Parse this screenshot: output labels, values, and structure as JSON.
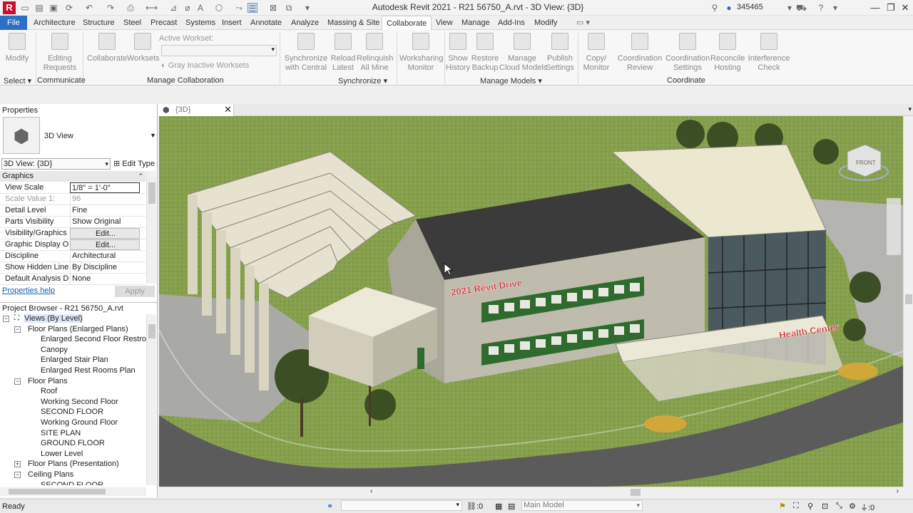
{
  "app": {
    "title": "Autodesk Revit 2021 - R21 56750_A.rvt - 3D View: {3D}",
    "user": "345465",
    "logo_letter": "R"
  },
  "tabs": [
    "File",
    "Architecture",
    "Structure",
    "Steel",
    "Precast",
    "Systems",
    "Insert",
    "Annotate",
    "Analyze",
    "Massing & Site",
    "Collaborate",
    "View",
    "Manage",
    "Add-Ins",
    "Modify"
  ],
  "active_tab": "Collaborate",
  "ribbon": {
    "modify": "Modify",
    "editing_requests": "Editing\nRequests",
    "collaborate": "Collaborate",
    "worksets": "Worksets",
    "active_workset_label": "Active Workset:",
    "gray_inactive": "Gray Inactive Worksets",
    "sync_central": "Synchronize\nwith Central",
    "reload_latest": "Reload\nLatest",
    "relinquish": "Relinquish\nAll Mine",
    "ws_monitor": "Worksharing\nMonitor",
    "show_history": "Show\nHistory",
    "restore_backup": "Restore\nBackup",
    "manage_cloud": "Manage\nCloud Models",
    "publish_settings": "Publish\nSettings",
    "copy_monitor": "Copy/\nMonitor",
    "coord_review": "Coordination\nReview",
    "coord_settings": "Coordination\nSettings",
    "reconcile": "Reconcile\nHosting",
    "interference": "Interference\nCheck",
    "panels": {
      "select": "Select",
      "communicate": "Communicate",
      "manage_collab": "Manage Collaboration",
      "synchronize": "Synchronize",
      "manage_models": "Manage Models",
      "coordinate": "Coordinate"
    }
  },
  "properties": {
    "title": "Properties",
    "type_name": "3D View",
    "instance": "3D View: {3D}",
    "edit_type": "Edit Type",
    "section": "Graphics",
    "rows": [
      {
        "k": "View Scale",
        "v": "1/8\" = 1'-0\""
      },
      {
        "k": "Scale Value    1:",
        "v": "96"
      },
      {
        "k": "Detail Level",
        "v": "Fine"
      },
      {
        "k": "Parts Visibility",
        "v": "Show Original"
      },
      {
        "k": "Visibility/Graphics ...",
        "v": "Edit..."
      },
      {
        "k": "Graphic Display O...",
        "v": "Edit..."
      },
      {
        "k": "Discipline",
        "v": "Architectural"
      },
      {
        "k": "Show Hidden Lines",
        "v": "By Discipline"
      },
      {
        "k": "Default Analysis Di...",
        "v": "None"
      }
    ],
    "help": "Properties help",
    "apply": "Apply"
  },
  "browser": {
    "title": "Project Browser - R21 56750_A.rvt",
    "items": [
      {
        "label": "Views (By Level)",
        "level": 0,
        "toggle": "−"
      },
      {
        "label": "Floor Plans (Enlarged Plans)",
        "level": 1,
        "toggle": "−"
      },
      {
        "label": "Enlarged Second Floor Restrooms",
        "level": 2
      },
      {
        "label": "Canopy",
        "level": 2
      },
      {
        "label": "Enlarged Stair Plan",
        "level": 2
      },
      {
        "label": "Enlarged Rest Rooms Plan",
        "level": 2
      },
      {
        "label": "Floor Plans",
        "level": 1,
        "toggle": "−"
      },
      {
        "label": "Roof",
        "level": 2
      },
      {
        "label": "Working Second Floor",
        "level": 2
      },
      {
        "label": "SECOND FLOOR",
        "level": 2
      },
      {
        "label": "Working Ground Floor",
        "level": 2
      },
      {
        "label": "SITE PLAN",
        "level": 2
      },
      {
        "label": "GROUND FLOOR",
        "level": 2
      },
      {
        "label": "Lower Level",
        "level": 2
      },
      {
        "label": "Floor Plans (Presentation)",
        "level": 1,
        "toggle": "+"
      },
      {
        "label": "Ceiling Plans",
        "level": 1,
        "toggle": "−"
      },
      {
        "label": "SECOND FLOOR",
        "level": 2
      }
    ]
  },
  "view": {
    "tab": "{3D}",
    "building_sign": "2021 Revit Drive",
    "health_sign": "Health Center",
    "viewcube_face": "FRONT"
  },
  "status": {
    "text": "Ready",
    "model": "Main Model",
    "sel_count": ":0",
    "filter_count": ":0"
  }
}
